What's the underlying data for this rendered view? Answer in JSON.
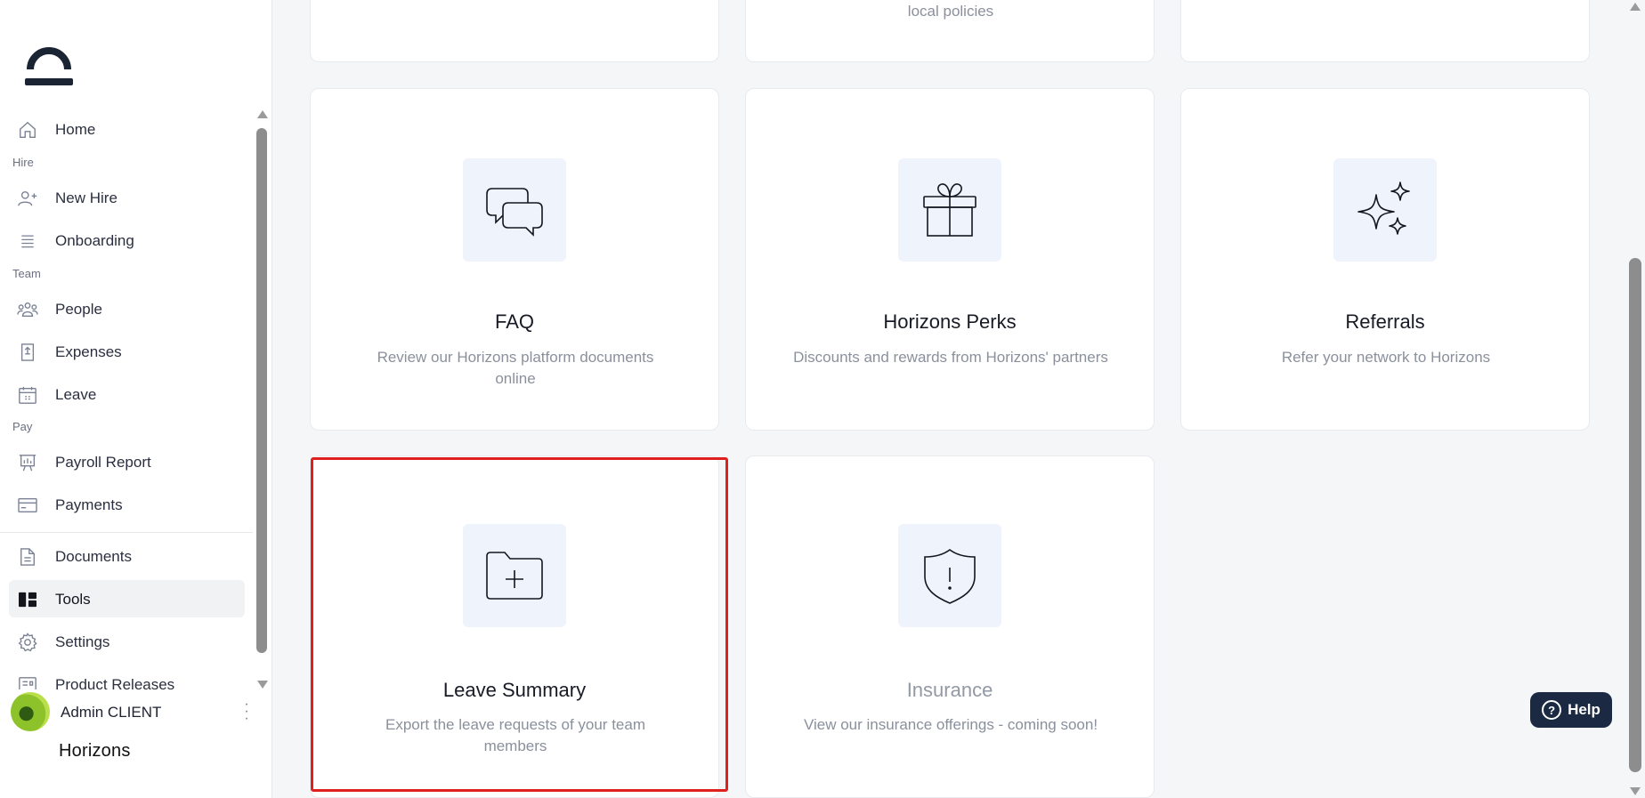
{
  "sidebar": {
    "logo_icon": "horizons-logo-icon",
    "items": [
      {
        "label": "Home",
        "icon": "home-icon"
      },
      {
        "label": "New Hire",
        "icon": "user-plus-icon"
      },
      {
        "label": "Onboarding",
        "icon": "list-icon"
      },
      {
        "label": "People",
        "icon": "people-icon"
      },
      {
        "label": "Expenses",
        "icon": "receipt-icon"
      },
      {
        "label": "Leave",
        "icon": "calendar-icon"
      },
      {
        "label": "Payroll Report",
        "icon": "presentation-icon"
      },
      {
        "label": "Payments",
        "icon": "card-icon"
      },
      {
        "label": "Documents",
        "icon": "document-icon"
      },
      {
        "label": "Tools",
        "icon": "tools-icon",
        "active": true
      },
      {
        "label": "Settings",
        "icon": "gear-icon"
      },
      {
        "label": "Product Releases",
        "icon": "releases-icon"
      }
    ],
    "sections": {
      "hire": "Hire",
      "team": "Team",
      "pay": "Pay"
    },
    "user": {
      "name": "Admin CLIENT"
    },
    "brand": "Horizons"
  },
  "cards_top_partial": {
    "middle_desc": "local policies"
  },
  "cards": [
    {
      "title": "FAQ",
      "desc": "Review our Horizons platform documents online",
      "icon": "chat-bubbles-icon"
    },
    {
      "title": "Horizons Perks",
      "desc": "Discounts and rewards from Horizons' partners",
      "icon": "gift-icon"
    },
    {
      "title": "Referrals",
      "desc": "Refer your network to Horizons",
      "icon": "sparkles-icon"
    },
    {
      "title": "Leave Summary",
      "desc": "Export the leave requests of your team members",
      "icon": "folder-plus-icon"
    },
    {
      "title": "Insurance",
      "desc": "View our insurance offerings - coming soon!",
      "icon": "shield-alert-icon",
      "disabled": true
    }
  ],
  "help": {
    "label": "Help"
  },
  "colors": {
    "highlight": "#e0201e",
    "help_bg": "#1b2a42",
    "icon_box": "#eff3fc"
  }
}
